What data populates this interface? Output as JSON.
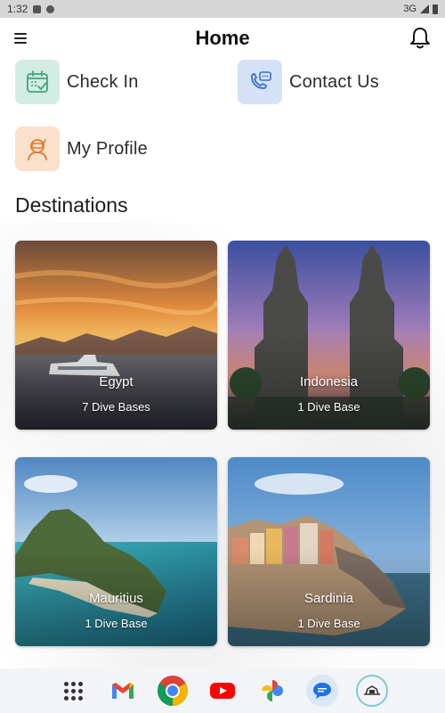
{
  "status_bar": {
    "time": "1:32",
    "network": "3G"
  },
  "header": {
    "title": "Home"
  },
  "actions": [
    {
      "label": "Check In",
      "icon": "calendar-check-icon",
      "color": "#d2ede3"
    },
    {
      "label": "Contact Us",
      "icon": "phone-chat-icon",
      "color": "#d4e1f7"
    },
    {
      "label": "My Profile",
      "icon": "diver-profile-icon",
      "color": "#fbe0cb"
    }
  ],
  "destinations_title": "Destinations",
  "destinations": [
    {
      "name": "Egypt",
      "bases": "7 Dive Bases"
    },
    {
      "name": "Indonesia",
      "bases": "1 Dive Base"
    },
    {
      "name": "Mauritius",
      "bases": "1 Dive Base"
    },
    {
      "name": "Sardinia",
      "bases": "1 Dive Base"
    }
  ],
  "dock": [
    "apps-grid-icon",
    "gmail-icon",
    "chrome-icon",
    "youtube-icon",
    "photos-icon",
    "messages-icon",
    "dive-app-icon"
  ],
  "colors": {
    "accent_green": "#3fa57d",
    "accent_blue": "#3b6fc9",
    "accent_orange": "#e07a2c"
  }
}
